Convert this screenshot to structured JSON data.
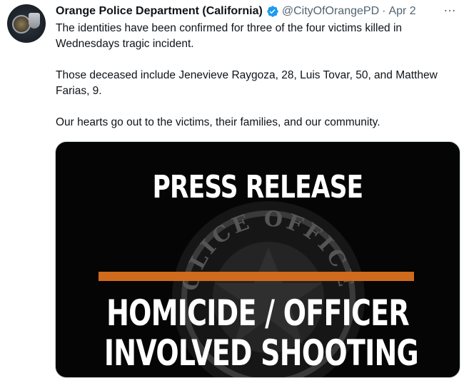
{
  "tweet": {
    "display_name": "Orange Police Department (California)",
    "handle": "@CityOfOrangePD",
    "separator": "·",
    "date": "Apr 2",
    "more_icon": "…",
    "verified_icon": "verified-badge-icon",
    "paragraphs": [
      "The identities have been confirmed for three of the four victims killed in Wednesdays tragic incident.",
      "Those deceased include Jenevieve Raygoza, 28, Luis Tovar, 50, and Matthew Farias, 9.",
      "Our hearts go out to the victims, their families, and our community."
    ]
  },
  "media": {
    "title": "PRESS RELEASE",
    "badge_text": "POLICE OFFICER",
    "headline_line1": "HOMICIDE / OFFICER",
    "headline_line2": "INVOLVED SHOOTING",
    "accent_color": "#d06a1c"
  }
}
